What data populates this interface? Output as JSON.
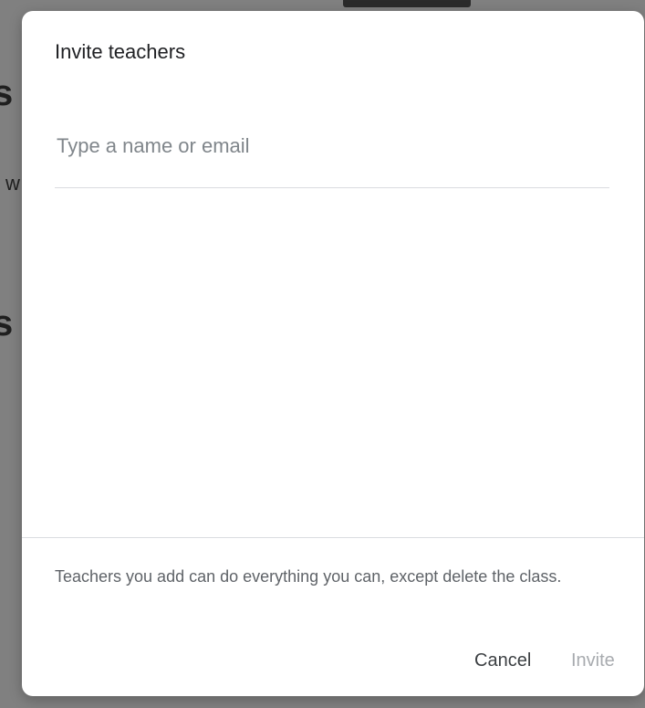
{
  "background": {
    "fragments": [
      "s",
      "w",
      "s"
    ]
  },
  "dialog": {
    "title": "Invite teachers",
    "input": {
      "placeholder": "Type a name or email",
      "value": ""
    },
    "note": "Teachers you add can do everything you can, except delete the class.",
    "buttons": {
      "cancel_label": "Cancel",
      "invite_label": "Invite"
    }
  },
  "colors": {
    "backdrop": "#808080",
    "dialog_bg": "#ffffff",
    "divider": "#dadce0",
    "disabled_text": "#a8abaf"
  }
}
